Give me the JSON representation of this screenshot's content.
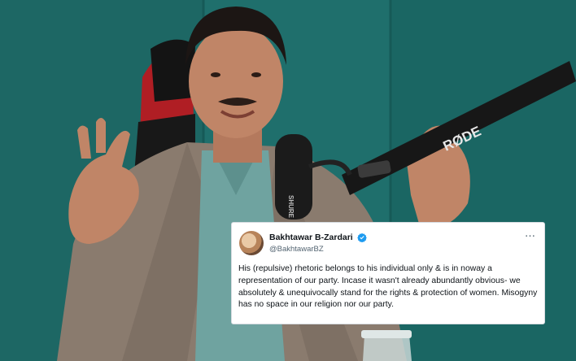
{
  "scene": {
    "description_free": true,
    "colors": {
      "wall": "#1f6f6c",
      "jacket": "#8a7b6e",
      "shirt": "#6fa3a0",
      "mic": "#1b1b1b",
      "arm": "#171717"
    },
    "mic_arm_brand": "RØDE",
    "mic_brand": "SHURE"
  },
  "tweet": {
    "display_name": "Bakhtawar B-Zardari",
    "handle": "@BakhtawarBZ",
    "more_icon": "…",
    "verified_color": "#1d9bf0",
    "text": "His (repulsive) rhetoric belongs to his individual only & is in noway a representation of our party. Incase it wasn't already abundantly obvious- we absolutely & unequivocally stand for the rights & protection of women. Misogyny has no space in our religion nor our party."
  }
}
